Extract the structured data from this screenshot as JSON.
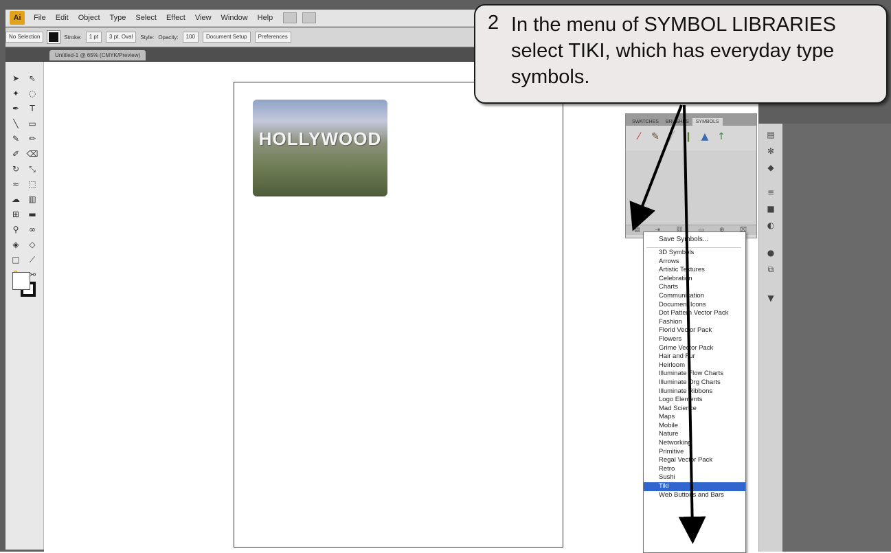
{
  "app": {
    "logo_text": "Ai",
    "menu": [
      "File",
      "Edit",
      "Object",
      "Type",
      "Select",
      "Effect",
      "View",
      "Window",
      "Help"
    ]
  },
  "control_bar": {
    "selection_label": "No Selection",
    "stroke_label": "Stroke:",
    "stroke_value": "1 pt",
    "brush_value": "3 pt. Oval",
    "style_label": "Style:",
    "opacity_label": "Opacity:",
    "opacity_value": "100",
    "doc_setup_label": "Document Setup",
    "preferences_label": "Preferences"
  },
  "document": {
    "tab_title": "Untitled-1 @ 65% (CMYK/Preview)",
    "photo_text": "HOLLYWOOD"
  },
  "symbols_panel": {
    "tabs": [
      "SWATCHES",
      "BRUSHES",
      "SYMBOLS"
    ],
    "active_tab": "SYMBOLS"
  },
  "library_menu": {
    "save_label": "Save Symbols...",
    "items": [
      "3D Symbols",
      "Arrows",
      "Artistic Textures",
      "Celebration",
      "Charts",
      "Communication",
      "Document Icons",
      "Dot Pattern Vector Pack",
      "Fashion",
      "Florid Vector Pack",
      "Flowers",
      "Grime Vector Pack",
      "Hair and Fur",
      "Heirloom",
      "Illuminate Flow Charts",
      "Illuminate Org Charts",
      "Illuminate Ribbons",
      "Logo Elements",
      "Mad Science",
      "Maps",
      "Mobile",
      "Nature",
      "Networking",
      "Primitive",
      "Regal Vector Pack",
      "Retro",
      "Sushi",
      "Tiki",
      "Web Buttons and Bars"
    ],
    "selected_item": "Tiki"
  },
  "callout": {
    "step_number": "2",
    "text": "In the menu of SYMBOL LIBRARIES select TIKI, which has everyday type symbols."
  },
  "colors": {
    "callout_bg": "#ece9e8",
    "menu_highlight": "#3166cf",
    "workspace": "#5e5e5e"
  }
}
